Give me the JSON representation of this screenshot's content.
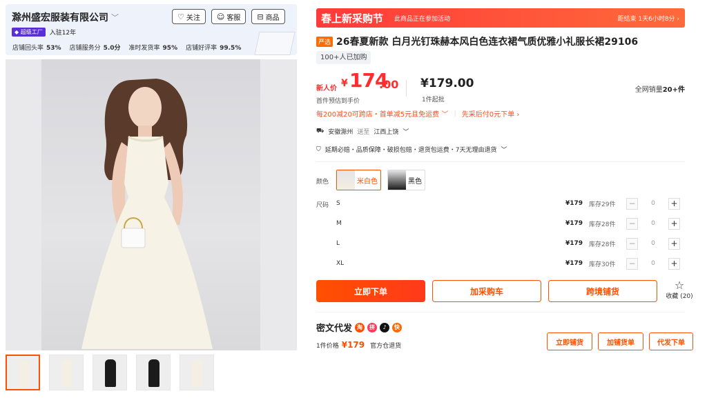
{
  "shop": {
    "name": "滁州盛宏服装有限公司",
    "buttons": {
      "follow": "关注",
      "service": "客服",
      "goods": "商品"
    },
    "badge": "超级工厂",
    "years": "入驻12年",
    "stats": [
      {
        "label": "店铺回头率",
        "value": "53%"
      },
      {
        "label": "店铺服务分",
        "value": "5.0分"
      },
      {
        "label": "准时发货率",
        "value": "95%"
      },
      {
        "label": "店铺好评率",
        "value": "99.5%"
      }
    ]
  },
  "promo": {
    "title": "春上新采购节",
    "status": "此商品正在参加活动",
    "countdown": "距结束 1天6小时8分 ›"
  },
  "product": {
    "tag": "严选",
    "title": "26春夏新款 白月光钉珠赫本风白色连衣裙气质优雅小礼服长裙29106",
    "buyers": "100+人已加购"
  },
  "price": {
    "new_label": "新人价",
    "currency": "¥",
    "int": "174",
    "dec": ".00",
    "new_sub": "首件预估到手价",
    "base": "¥179.00",
    "base_sub": "1件起批",
    "sales_label": "全网销量",
    "sales_value": "20+件"
  },
  "coupons": {
    "c1": "每200减20可跨店・首单减5元且免运费",
    "c2": "先采后付0元下单"
  },
  "shipping": {
    "from": "安徽滁州",
    "to_label": "送至",
    "to": "江西上饶"
  },
  "guarantee": "延期必赔・品质保障・破损包赔・退货包运费・7天无理由退货",
  "spec": {
    "color_label": "颜色",
    "colors": [
      "米白色",
      "黑色"
    ],
    "size_label": "尺码",
    "sizes": [
      {
        "size": "S",
        "price": "¥179",
        "stock": "库存29件",
        "qty": "0"
      },
      {
        "size": "M",
        "price": "¥179",
        "stock": "库存28件",
        "qty": "0"
      },
      {
        "size": "L",
        "price": "¥179",
        "stock": "库存28件",
        "qty": "0"
      },
      {
        "size": "XL",
        "price": "¥179",
        "stock": "库存30件",
        "qty": "0"
      }
    ]
  },
  "actions": {
    "buy": "立即下单",
    "cart": "加采购车",
    "dist": "跨境铺货",
    "fav": "收藏 (20)"
  },
  "mw": {
    "title": "密文代发",
    "price_label": "1件价格",
    "price": "¥179",
    "return": "官方仓退货",
    "b1": "立即铺货",
    "b2": "加铺货单",
    "b3": "代发下单"
  },
  "colors": {
    "accent": "#ff5000",
    "promo": "#ff3a3a",
    "price": "#ff2d2d"
  }
}
